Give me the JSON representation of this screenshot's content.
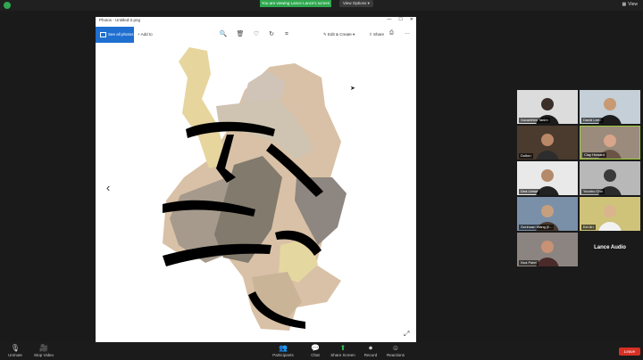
{
  "top": {
    "share_banner": "You are viewing Lance Lance's screen",
    "view_options": "View Options ▾",
    "view": "View"
  },
  "photos": {
    "title": "Photos - Untitled-2.png",
    "see_all": "See all photos",
    "add_to": "Add to",
    "edit_create": "Edit & Create ▾",
    "share": "Share"
  },
  "participants": [
    {
      "name": "Xavanthim Tanim",
      "bg": "#dcdcdc",
      "skin": "#3a2e28",
      "shirt": "#1c1c1c"
    },
    {
      "name": "David Lee...",
      "bg": "#c4cfd8",
      "skin": "#c79a74",
      "shirt": "#1d1d1d"
    },
    {
      "name": "Dolton",
      "bg": "#4a3b2e",
      "skin": "#b98866",
      "shirt": "#2d2d2d"
    },
    {
      "name": "Clay Howard",
      "bg": "#9a8b7c",
      "skin": "#d8a58a",
      "shirt": "#6b5446",
      "active": true
    },
    {
      "name": "Dea Lense",
      "bg": "#e9e9e9",
      "skin": "#b48a6a",
      "shirt": "#222222"
    },
    {
      "name": "Yoonho Cho",
      "bg": "#b8b8b8",
      "skin": "#3a3a3a",
      "shirt": "#2a2a2a"
    },
    {
      "name": "Gunhuan Wang (li...",
      "bg": "#7a8fa8",
      "skin": "#c6a07e",
      "shirt": "#4a3a2e"
    },
    {
      "name": "Kei An",
      "bg": "#cfc37a",
      "skin": "#d9b48c",
      "shirt": "#f2f2f2"
    },
    {
      "name": "Noa Patel",
      "bg": "#8c8480",
      "skin": "#c89274",
      "shirt": "#4a2a2a"
    },
    {
      "name": "Lance Audio",
      "bg": "#1a1a1a",
      "audio": true
    }
  ],
  "controls": [
    {
      "key": "unmute",
      "label": "Unmute",
      "icon": "🎙"
    },
    {
      "key": "stop-video",
      "label": "Stop Video",
      "icon": "🎥"
    },
    {
      "key": "participants",
      "label": "Participants",
      "icon": "👥"
    },
    {
      "key": "chat",
      "label": "Chat",
      "icon": "💬"
    },
    {
      "key": "share-screen",
      "label": "Share Screen",
      "icon": "⬆"
    },
    {
      "key": "record",
      "label": "Record",
      "icon": "⏺"
    },
    {
      "key": "reactions",
      "label": "Reactions",
      "icon": "☺"
    }
  ],
  "participant_count": "10",
  "leave": "Leave"
}
